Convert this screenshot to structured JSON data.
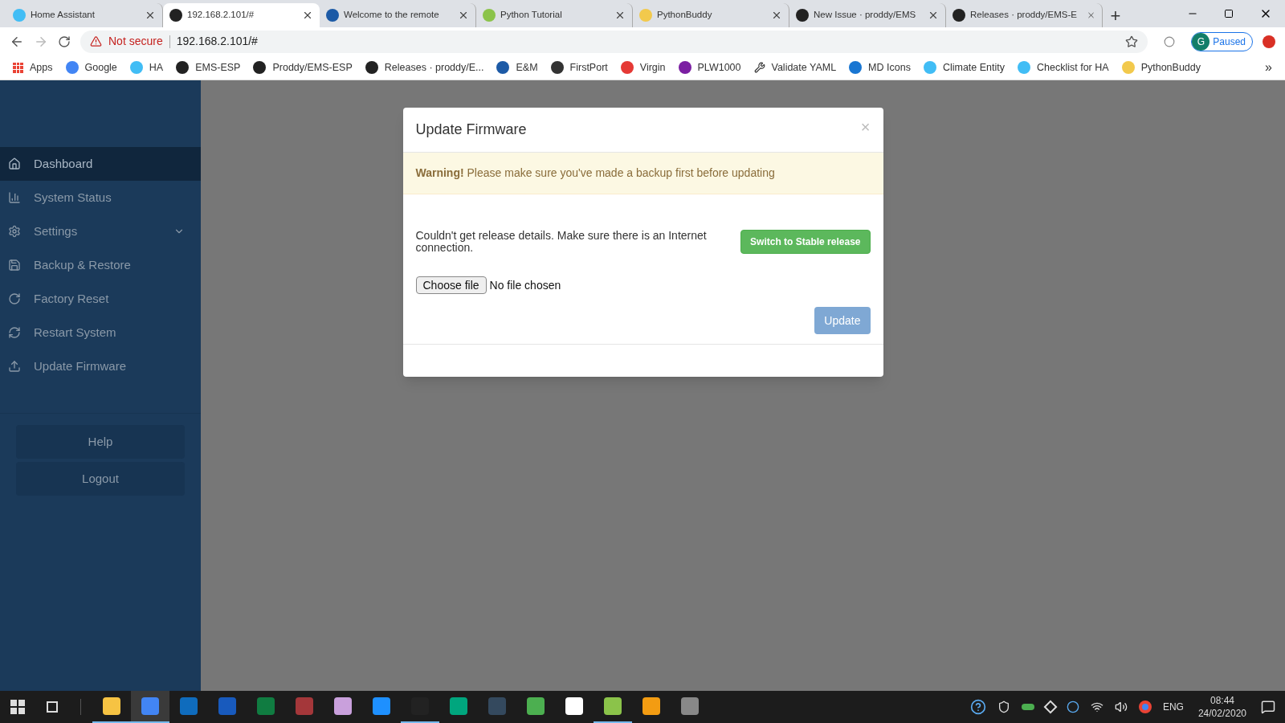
{
  "browser": {
    "tabs": [
      {
        "title": "Home Assistant",
        "selected": false
      },
      {
        "title": "192.168.2.101/#",
        "selected": true
      },
      {
        "title": "Welcome to the remote",
        "selected": false
      },
      {
        "title": "Python Tutorial",
        "selected": false
      },
      {
        "title": "PythonBuddy",
        "selected": false
      },
      {
        "title": "New Issue · proddy/EMS",
        "selected": false
      },
      {
        "title": "Releases · proddy/EMS-E",
        "selected": false
      }
    ],
    "new_tab": "+",
    "address": {
      "security": "Not secure",
      "url": "192.168.2.101/#"
    },
    "profile": {
      "initial": "G",
      "status": "Paused"
    },
    "bookmarks": [
      {
        "label": "Apps"
      },
      {
        "label": "Google"
      },
      {
        "label": "HA"
      },
      {
        "label": "EMS-ESP"
      },
      {
        "label": "Proddy/EMS-ESP"
      },
      {
        "label": "Releases · proddy/E..."
      },
      {
        "label": "E&M"
      },
      {
        "label": "FirstPort"
      },
      {
        "label": "Virgin"
      },
      {
        "label": "PLW1000"
      },
      {
        "label": "Validate YAML"
      },
      {
        "label": "MD Icons"
      },
      {
        "label": "Climate Entity"
      },
      {
        "label": "Checklist for HA"
      },
      {
        "label": "PythonBuddy"
      }
    ],
    "bookmarks_more": "»"
  },
  "sidebar": {
    "items": [
      {
        "label": "Dashboard",
        "selected": true
      },
      {
        "label": "System Status",
        "selected": false
      },
      {
        "label": "Settings",
        "selected": false,
        "expanded": false
      },
      {
        "label": "Backup & Restore",
        "selected": false
      },
      {
        "label": "Factory Reset",
        "selected": false
      },
      {
        "label": "Restart System",
        "selected": false
      },
      {
        "label": "Update Firmware",
        "selected": false
      }
    ],
    "buttons": [
      "Help",
      "Logout"
    ]
  },
  "modal": {
    "title": "Update Firmware",
    "close": "×",
    "warning": "**Warning!** Please make sure you've made a backup first before updating",
    "message": "Couldn't get release details. Make sure there is an Internet connection.",
    "switch_button": "Switch to Stable release",
    "file_input": {
      "button": "Choose file",
      "status": "No file chosen"
    },
    "update_button": {
      "label": "Update",
      "disabled": true
    }
  },
  "taskbar": {
    "apps": [
      {
        "running": true,
        "selected": false
      },
      {
        "running": true,
        "selected": true
      },
      {
        "running": false,
        "selected": false
      },
      {
        "running": false,
        "selected": false
      },
      {
        "running": false,
        "selected": false
      },
      {
        "running": false,
        "selected": false
      },
      {
        "running": false,
        "selected": false
      },
      {
        "running": false,
        "selected": false
      },
      {
        "running": true,
        "selected": false
      },
      {
        "running": false,
        "selected": false
      },
      {
        "running": false,
        "selected": false
      },
      {
        "running": false,
        "selected": false
      },
      {
        "running": false,
        "selected": false
      },
      {
        "running": true,
        "selected": false
      },
      {
        "running": false,
        "selected": false
      },
      {
        "running": false,
        "selected": false
      }
    ],
    "language": "ENG",
    "time": "08:44",
    "date": "24/02/2020"
  }
}
